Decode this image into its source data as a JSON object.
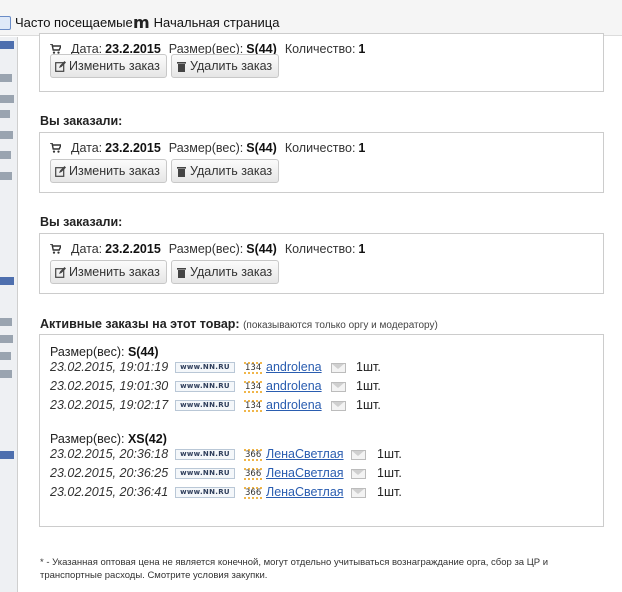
{
  "bookmarks": {
    "items": [
      {
        "label": "Часто посещаемые",
        "icon": "page-icon"
      },
      {
        "label": "Начальная страница",
        "icon": "m-logo-icon"
      }
    ]
  },
  "orders": [
    {
      "heading": "",
      "date_label": "Дата:",
      "date": "23.2.2015",
      "size_label": "Размер(вес):",
      "size": "S(44)",
      "qty_label": "Количество:",
      "qty": "1",
      "edit_label": "Изменить заказ",
      "delete_label": "Удалить заказ"
    },
    {
      "heading": "Вы заказали:",
      "date_label": "Дата:",
      "date": "23.2.2015",
      "size_label": "Размер(вес):",
      "size": "S(44)",
      "qty_label": "Количество:",
      "qty": "1",
      "edit_label": "Изменить заказ",
      "delete_label": "Удалить заказ"
    },
    {
      "heading": "Вы заказали:",
      "date_label": "Дата:",
      "date": "23.2.2015",
      "size_label": "Размер(вес):",
      "size": "S(44)",
      "qty_label": "Количество:",
      "qty": "1",
      "edit_label": "Изменить заказ",
      "delete_label": "Удалить заказ"
    }
  ],
  "active": {
    "title": "Активные заказы на этот товар:",
    "note": "(показываются только оргу и модератору)",
    "groups": [
      {
        "size_label": "Размер(вес):",
        "size": "S(44)",
        "rows": [
          {
            "time": "23.02.2015, 19:01:19",
            "badge": "www.NN.RU",
            "rating": "134",
            "user": "androlena",
            "qty": "1шт."
          },
          {
            "time": "23.02.2015, 19:01:30",
            "badge": "www.NN.RU",
            "rating": "134",
            "user": "androlena",
            "qty": "1шт."
          },
          {
            "time": "23.02.2015, 19:02:17",
            "badge": "www.NN.RU",
            "rating": "134",
            "user": "androlena",
            "qty": "1шт."
          }
        ]
      },
      {
        "size_label": "Размер(вес):",
        "size": "XS(42)",
        "rows": [
          {
            "time": "23.02.2015, 20:36:18",
            "badge": "www.NN.RU",
            "rating": "366",
            "user": "ЛенаСветлая",
            "qty": "1шт."
          },
          {
            "time": "23.02.2015, 20:36:25",
            "badge": "www.NN.RU",
            "rating": "366",
            "user": "ЛенаСветлая",
            "qty": "1шт."
          },
          {
            "time": "23.02.2015, 20:36:41",
            "badge": "www.NN.RU",
            "rating": "366",
            "user": "ЛенаСветлая",
            "qty": "1шт."
          }
        ]
      }
    ]
  },
  "footnote": "* - Указанная оптовая цена не является конечной, могут отдельно учитываться вознаграждание орга, сбор за ЦР и транспортные расходы. Смотрите условия закупки."
}
